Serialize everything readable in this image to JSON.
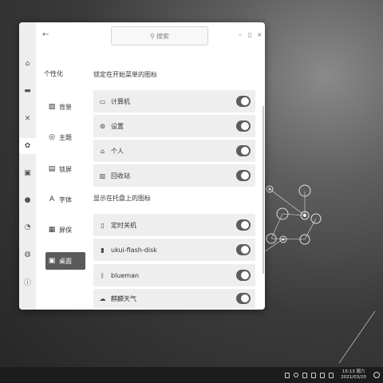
{
  "colors": {
    "window_bg": "#ffffff",
    "rail_bg": "#eeeeee",
    "row_bg": "#eeeeee",
    "active_nav": "#5a5a5a",
    "toggle_on": "#5c5c5c",
    "taskbar": "#1c1c1c"
  },
  "window": {
    "search_placeholder": "搜索",
    "search_icon": "search-icon",
    "back_icon": "back-arrow-icon",
    "minimize": "–",
    "maximize": "▯",
    "close": "×"
  },
  "rail": {
    "items": [
      {
        "icon": "home-icon",
        "glyph": "⌂"
      },
      {
        "icon": "monitor-icon",
        "glyph": "▬"
      },
      {
        "icon": "tools-icon",
        "glyph": "✕"
      },
      {
        "icon": "personalize-icon",
        "glyph": "✿"
      },
      {
        "icon": "network-icon",
        "glyph": "▣"
      },
      {
        "icon": "account-icon",
        "glyph": "●"
      },
      {
        "icon": "time-icon",
        "glyph": "◔"
      },
      {
        "icon": "update-icon",
        "glyph": "◍"
      },
      {
        "icon": "info-icon",
        "glyph": "ⓘ"
      }
    ]
  },
  "nav": {
    "title": "个性化",
    "items": [
      {
        "label": "背景",
        "icon": "background-icon",
        "glyph": "▨"
      },
      {
        "label": "主题",
        "icon": "theme-icon",
        "glyph": "◎"
      },
      {
        "label": "锁屏",
        "icon": "lockscreen-icon",
        "glyph": "▤"
      },
      {
        "label": "字体",
        "icon": "font-icon",
        "glyph": "A"
      },
      {
        "label": "屏保",
        "icon": "screensaver-icon",
        "glyph": "▦"
      },
      {
        "label": "桌面",
        "icon": "desktop-icon",
        "glyph": "▣"
      }
    ],
    "active_index": 5
  },
  "sections": [
    {
      "title": "锁定在开始菜单的图标",
      "rows": [
        {
          "label": "计算机",
          "icon": "computer-icon",
          "glyph": "▭",
          "on": true
        },
        {
          "label": "设置",
          "icon": "settings-icon",
          "glyph": "⚙",
          "on": true
        },
        {
          "label": "个人",
          "icon": "home-folder-icon",
          "glyph": "⌂",
          "on": true
        },
        {
          "label": "回收站",
          "icon": "trash-icon",
          "glyph": "▥",
          "on": true
        }
      ]
    },
    {
      "title": "显示在托盘上的图标",
      "rows": [
        {
          "label": "定时关机",
          "icon": "shutdown-timer-icon",
          "glyph": "▯",
          "on": true
        },
        {
          "label": "ukui-flash-disk",
          "icon": "flash-disk-icon",
          "glyph": "▮",
          "on": true
        },
        {
          "label": "blueman",
          "icon": "bluetooth-icon",
          "glyph": "ᛒ",
          "on": true
        },
        {
          "label": "麒麟天气",
          "icon": "weather-icon",
          "glyph": "☁",
          "on": true
        }
      ]
    }
  ],
  "taskbar": {
    "time": "15:13 周六",
    "date": "2021/03/20"
  }
}
